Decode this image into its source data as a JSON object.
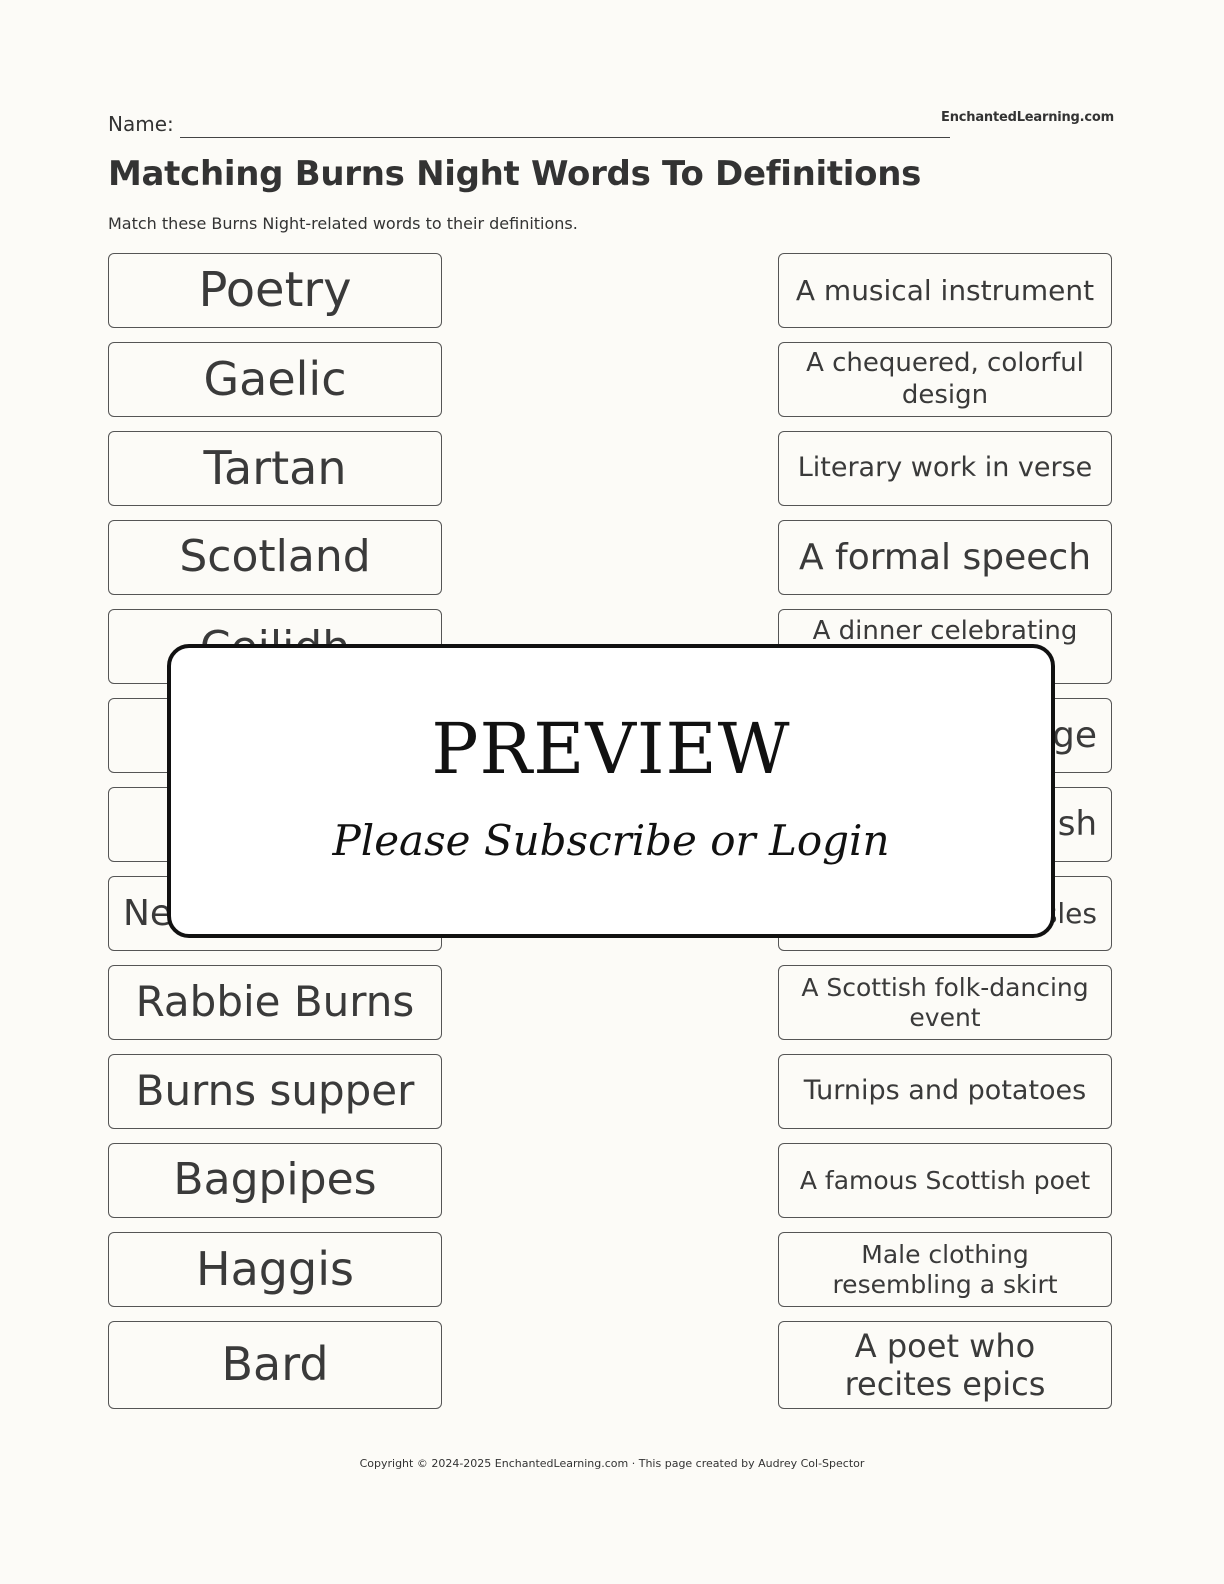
{
  "header": {
    "name_label": "Name:",
    "brand": "EnchantedLearning.com",
    "title": "Matching Burns Night Words To Definitions",
    "subtitle": "Match these Burns Night-related words to their definitions."
  },
  "words": [
    {
      "text": "Poetry"
    },
    {
      "text": "Gaelic"
    },
    {
      "text": "Tartan"
    },
    {
      "text": "Scotland"
    },
    {
      "text": "Ceilidh"
    },
    {
      "text": ""
    },
    {
      "text": ""
    },
    {
      "text": "Neeps"
    },
    {
      "text": "Rabbie Burns"
    },
    {
      "text": "Burns supper"
    },
    {
      "text": "Bagpipes"
    },
    {
      "text": "Haggis"
    },
    {
      "text": "Bard"
    }
  ],
  "definitions": [
    {
      "text": "A musical instrument"
    },
    {
      "text": "A chequered, colorful design"
    },
    {
      "text": "Literary work in verse"
    },
    {
      "text": "A formal speech"
    },
    {
      "text": "A dinner celebrating"
    },
    {
      "text": "ge"
    },
    {
      "text": "ish"
    },
    {
      "text": "sles"
    },
    {
      "text": "A Scottish folk-dancing event"
    },
    {
      "text": "Turnips and potatoes"
    },
    {
      "text": "A famous Scottish poet"
    },
    {
      "text": "Male clothing resembling a skirt"
    },
    {
      "text": "A poet who recites epics"
    }
  ],
  "overlay": {
    "title": "PREVIEW",
    "message": "Please Subscribe or Login"
  },
  "footer": {
    "text": "Copyright © 2024-2025 EnchantedLearning.com · This page created by Audrey Col-Spector"
  }
}
